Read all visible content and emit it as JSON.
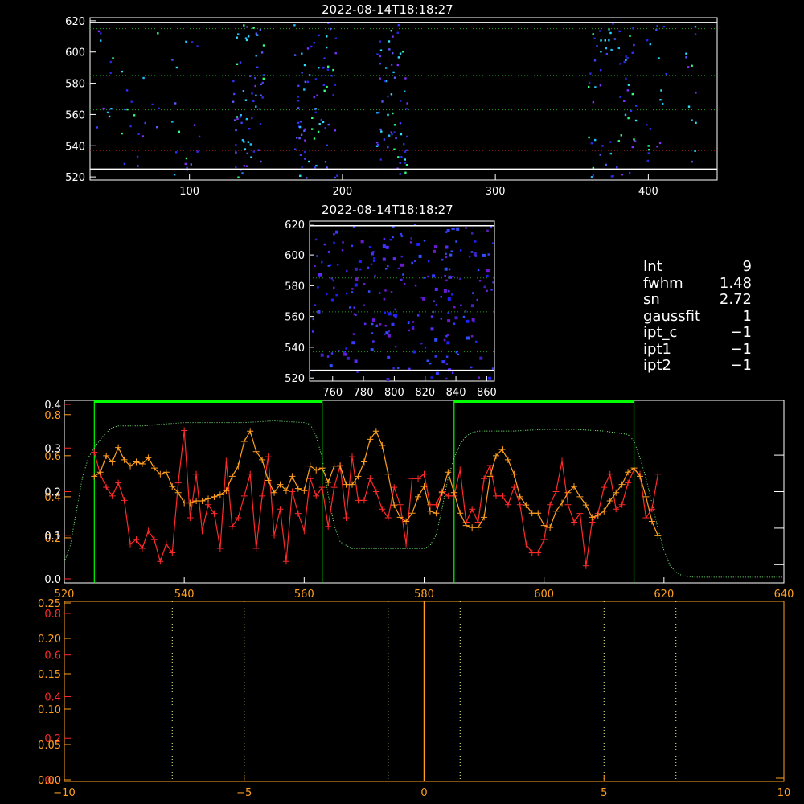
{
  "top_panel": {
    "title": "2022-08-14T18:18:27",
    "xticks": [
      "100",
      "200",
      "300",
      "400"
    ],
    "yticks": [
      "520",
      "540",
      "560",
      "580",
      "600",
      "620"
    ]
  },
  "mid_panel": {
    "title": "2022-08-14T18:18:27",
    "xticks": [
      "760",
      "780",
      "800",
      "820",
      "840",
      "860"
    ],
    "yticks": [
      "520",
      "540",
      "560",
      "580",
      "600",
      "620"
    ]
  },
  "info": [
    {
      "key": "Int",
      "value": "9"
    },
    {
      "key": "fwhm",
      "value": "1.48"
    },
    {
      "key": "sn",
      "value": "2.72"
    },
    {
      "key": "gaussfit",
      "value": "1"
    },
    {
      "key": "ipt_c",
      "value": "−1"
    },
    {
      "key": "ipt1",
      "value": "−1"
    },
    {
      "key": "ipt2",
      "value": "−1"
    }
  ],
  "colors": {
    "red": "#ff2a2a",
    "orange": "#ffa020",
    "green": "#00ff00",
    "frame": "#ffffff"
  },
  "chart_data": [
    {
      "type": "heatmap",
      "title": "2022-08-14T18:18:27",
      "xlim": [
        35,
        445
      ],
      "ylim": [
        518,
        622
      ],
      "note_lines_y": [
        537,
        563,
        585,
        615
      ],
      "white_lines_y": [
        525,
        619
      ]
    },
    {
      "type": "heatmap",
      "title": "2022-08-14T18:18:27",
      "xlim": [
        745,
        865
      ],
      "ylim": [
        518,
        622
      ]
    },
    {
      "type": "line",
      "xlim": [
        520,
        640
      ],
      "xticks": [
        "520",
        "540",
        "560",
        "580",
        "600",
        "620",
        "640"
      ],
      "left_axis_orange": {
        "labels": [
          "0.2",
          "0.4",
          "0.6",
          "0.8"
        ],
        "values": [
          0.2,
          0.4,
          0.6,
          0.8
        ],
        "ylim": [
          0,
          0.85
        ]
      },
      "left_axis_red": {
        "labels": [
          "0.0",
          "0.1",
          "0.2",
          "0.3",
          "0.4"
        ],
        "values": [
          0.0,
          0.1,
          0.2,
          0.3,
          0.4
        ],
        "ylim": [
          0,
          0.4
        ]
      },
      "green_windows": [
        [
          525,
          563
        ],
        [
          585,
          615
        ]
      ],
      "series": [
        {
          "color": "red",
          "x": [
            525,
            526,
            527,
            528,
            529,
            530,
            531,
            532,
            533,
            534,
            535,
            536,
            537,
            538,
            539,
            540,
            541,
            542,
            543,
            544,
            545,
            546,
            547,
            548,
            549,
            550,
            551,
            552,
            553,
            554,
            555,
            556,
            557,
            558,
            559,
            560,
            561,
            562,
            563,
            564,
            565,
            566,
            567,
            568,
            569,
            570,
            571,
            572,
            573,
            574,
            575,
            576,
            577,
            578,
            579,
            580,
            581,
            582,
            583,
            584,
            585,
            586,
            587,
            588,
            589,
            590,
            591,
            592,
            593,
            594,
            595,
            596,
            597,
            598,
            599,
            600,
            601,
            602,
            603,
            604,
            605,
            606,
            607,
            608,
            609,
            610,
            611,
            612,
            613,
            614,
            615,
            616,
            617,
            618,
            619
          ],
          "y": [
            0.29,
            0.24,
            0.21,
            0.19,
            0.22,
            0.18,
            0.08,
            0.09,
            0.07,
            0.11,
            0.09,
            0.04,
            0.08,
            0.06,
            0.22,
            0.34,
            0.14,
            0.24,
            0.11,
            0.17,
            0.15,
            0.07,
            0.27,
            0.12,
            0.14,
            0.19,
            0.24,
            0.07,
            0.19,
            0.28,
            0.1,
            0.16,
            0.04,
            0.2,
            0.15,
            0.11,
            0.23,
            0.19,
            0.21,
            0.12,
            0.21,
            0.26,
            0.14,
            0.28,
            0.18,
            0.18,
            0.23,
            0.2,
            0.16,
            0.14,
            0.21,
            0.17,
            0.08,
            0.23,
            0.23,
            0.24,
            0.17,
            0.17,
            0.2,
            0.19,
            0.19,
            0.25,
            0.13,
            0.16,
            0.13,
            0.23,
            0.26,
            0.19,
            0.19,
            0.17,
            0.21,
            0.17,
            0.08,
            0.06,
            0.06,
            0.09,
            0.17,
            0.2,
            0.27,
            0.17,
            0.13,
            0.15,
            0.03,
            0.13,
            0.15,
            0.21,
            0.24,
            0.16,
            0.17,
            0.22,
            0.25,
            0.24,
            0.14,
            0.16,
            0.24
          ]
        },
        {
          "color": "orange",
          "x": [
            525,
            526,
            527,
            528,
            529,
            530,
            531,
            532,
            533,
            534,
            535,
            536,
            537,
            538,
            539,
            540,
            541,
            542,
            543,
            544,
            545,
            546,
            547,
            548,
            549,
            550,
            551,
            552,
            553,
            554,
            555,
            556,
            557,
            558,
            559,
            560,
            561,
            562,
            563,
            564,
            565,
            566,
            567,
            568,
            569,
            570,
            571,
            572,
            573,
            574,
            575,
            576,
            577,
            578,
            579,
            580,
            581,
            582,
            583,
            584,
            585,
            586,
            587,
            588,
            589,
            590,
            591,
            592,
            593,
            594,
            595,
            596,
            597,
            598,
            599,
            600,
            601,
            602,
            603,
            604,
            605,
            606,
            607,
            608,
            609,
            610,
            611,
            612,
            613,
            614,
            615,
            616,
            617,
            618,
            619
          ],
          "y": [
            0.5,
            0.52,
            0.6,
            0.57,
            0.64,
            0.58,
            0.55,
            0.57,
            0.56,
            0.59,
            0.54,
            0.51,
            0.52,
            0.45,
            0.42,
            0.37,
            0.37,
            0.38,
            0.38,
            0.39,
            0.4,
            0.41,
            0.43,
            0.5,
            0.55,
            0.67,
            0.72,
            0.62,
            0.58,
            0.48,
            0.42,
            0.46,
            0.43,
            0.5,
            0.44,
            0.43,
            0.55,
            0.53,
            0.54,
            0.47,
            0.55,
            0.55,
            0.46,
            0.46,
            0.5,
            0.57,
            0.68,
            0.72,
            0.65,
            0.51,
            0.36,
            0.3,
            0.28,
            0.32,
            0.4,
            0.45,
            0.33,
            0.32,
            0.42,
            0.52,
            0.42,
            0.32,
            0.26,
            0.25,
            0.25,
            0.3,
            0.5,
            0.6,
            0.63,
            0.58,
            0.51,
            0.4,
            0.36,
            0.32,
            0.32,
            0.26,
            0.25,
            0.33,
            0.37,
            0.42,
            0.45,
            0.4,
            0.36,
            0.3,
            0.31,
            0.33,
            0.38,
            0.42,
            0.46,
            0.52,
            0.54,
            0.5,
            0.4,
            0.28,
            0.21
          ]
        },
        {
          "color": "green",
          "style": "dotted",
          "x": [
            520,
            521,
            522,
            523,
            524,
            525,
            526,
            527,
            528,
            529,
            530,
            533,
            536,
            540,
            545,
            550,
            555,
            560,
            561,
            562,
            563,
            564,
            565,
            566,
            567,
            568,
            570,
            575,
            580,
            581,
            582,
            583,
            584,
            585,
            586,
            587,
            588,
            589,
            590,
            595,
            600,
            605,
            610,
            614,
            615,
            616,
            617,
            618,
            619,
            620,
            621,
            622,
            623,
            625,
            630,
            635,
            640
          ],
          "y": [
            0.1,
            0.2,
            0.4,
            0.6,
            0.72,
            0.78,
            0.83,
            0.87,
            0.9,
            0.91,
            0.91,
            0.91,
            0.92,
            0.93,
            0.93,
            0.93,
            0.94,
            0.93,
            0.92,
            0.85,
            0.72,
            0.5,
            0.32,
            0.22,
            0.2,
            0.18,
            0.18,
            0.18,
            0.18,
            0.2,
            0.26,
            0.42,
            0.6,
            0.72,
            0.8,
            0.85,
            0.87,
            0.88,
            0.88,
            0.88,
            0.89,
            0.89,
            0.88,
            0.86,
            0.82,
            0.72,
            0.6,
            0.45,
            0.3,
            0.17,
            0.08,
            0.04,
            0.02,
            0.01,
            0.01,
            0.01,
            0.01
          ]
        }
      ]
    },
    {
      "type": "line",
      "xlim": [
        -10,
        10
      ],
      "xticks": [
        "−10",
        "−5",
        "0",
        "5",
        "10"
      ],
      "left_axis_orange": {
        "labels": [
          "0.00",
          "0.05",
          "0.10",
          "0.15",
          "0.20",
          "0.25"
        ],
        "values": [
          0,
          0.05,
          0.1,
          0.15,
          0.2,
          0.25
        ],
        "ylim": [
          0,
          0.25
        ]
      },
      "left_axis_red": {
        "labels": [
          "0.0",
          "0.2",
          "0.4",
          "0.6",
          "0.8"
        ],
        "values": [
          0,
          0.2,
          0.4,
          0.6,
          0.8
        ],
        "ylim": [
          0,
          0.85
        ]
      },
      "vertical_dotted_x": [
        -7,
        -5,
        -1,
        1,
        5,
        7
      ],
      "center_line_x": 0
    }
  ]
}
